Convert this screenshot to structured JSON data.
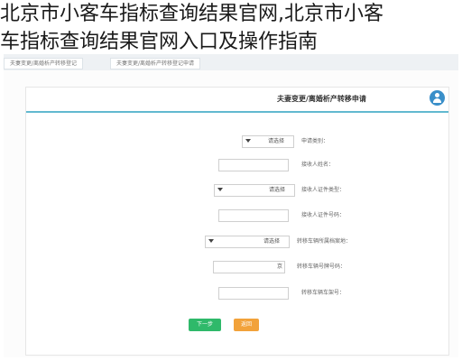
{
  "headline": {
    "line1": "北京市小客车指标查询结果官网,北京市小客",
    "line2": "车指标查询结果官网入口及操作指南"
  },
  "browser": {
    "tabs": [
      "夫妻变更/离婚析产转移登记",
      "夫妻变更/离婚析产转移登记申请"
    ]
  },
  "form": {
    "title": "夫妻变更/离婚析产转移申请",
    "rows": [
      {
        "label": "申请类别：",
        "type": "select",
        "value": "请选择"
      },
      {
        "label": "接收人姓名：",
        "type": "input",
        "value": ""
      },
      {
        "label": "接收人证件类型：",
        "type": "select",
        "value": "请选择"
      },
      {
        "label": "接收人证件号码：",
        "type": "input",
        "value": ""
      },
      {
        "label": "转移车辆所属档案地：",
        "type": "select",
        "value": "请选择"
      },
      {
        "label": "转移车辆号牌号码：",
        "type": "input-prefix",
        "prefix": "京",
        "value": ""
      },
      {
        "label": "转移车辆车架号：",
        "type": "input",
        "value": ""
      }
    ],
    "buttons": {
      "next": "下一步",
      "return": "返回"
    }
  },
  "colors": {
    "accent_line": "#62b9d0",
    "next_button": "#2fb96a",
    "return_button": "#f2a23a",
    "user_icon": "#3a8fc9"
  },
  "icons": {
    "user": "user-icon",
    "dropdown": "chevron-down-icon"
  }
}
